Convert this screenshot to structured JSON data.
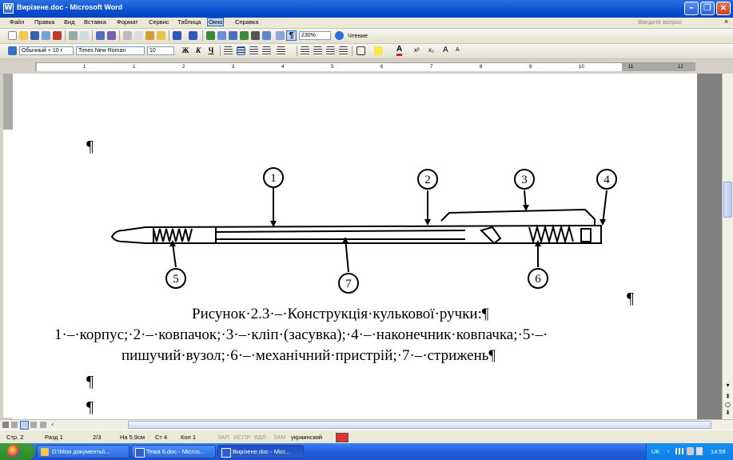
{
  "window": {
    "title": "Вирізене.doc - Microsoft Word",
    "icon": "W"
  },
  "menu": {
    "items": [
      "Файл",
      "Правка",
      "Вид",
      "Вставка",
      "Формат",
      "Сервис",
      "Таблица",
      "Окно",
      "Справка"
    ],
    "help_placeholder": "Введите вопрос",
    "close_doc": "×"
  },
  "toolbar": {
    "zoom": "230%",
    "reading": "Чтение",
    "style": "Обычный + 10 г",
    "font": "Times New Roman",
    "size": "10",
    "bold": "Ж",
    "italic": "К",
    "underline": "Ч",
    "pilcrow": "¶"
  },
  "ruler": {
    "numbers": [
      "1",
      "1",
      "2",
      "3",
      "4",
      "5",
      "6",
      "7",
      "8",
      "9",
      "10",
      "11",
      "12",
      "13"
    ]
  },
  "document": {
    "pilcrow": "¶",
    "figure_labels": [
      "1",
      "2",
      "3",
      "4",
      "5",
      "6",
      "7"
    ],
    "caption_line1": "Рисунок·2.3·–·Конструкція·кулькової·ручки:¶",
    "caption_line2": "1·–·корпус;·2·–·ковпачок;·3·–·кліп·(засувка);·4·–·наконечник·ковпачка;·5·–·",
    "caption_line3": "пишучий·вузол;·6·–·механічний·пристрій;·7·–·стрижень¶"
  },
  "status": {
    "page": "Стр. 2",
    "section": "Разд 1",
    "pages": "2/3",
    "at": "На 5,9см",
    "line": "Ст 4",
    "col": "Кол 1",
    "rec": "ЗАП",
    "trk": "ИСПР",
    "ext": "ВДЛ",
    "ovr": "ЗАМ",
    "lang": "украинский"
  },
  "taskbar": {
    "tasks": [
      "D:\\Мои документы\\...",
      "Тема 6.doc - Micros...",
      "Вирізене.doc - Micr..."
    ],
    "lang": "UK",
    "clock": "14:58"
  }
}
